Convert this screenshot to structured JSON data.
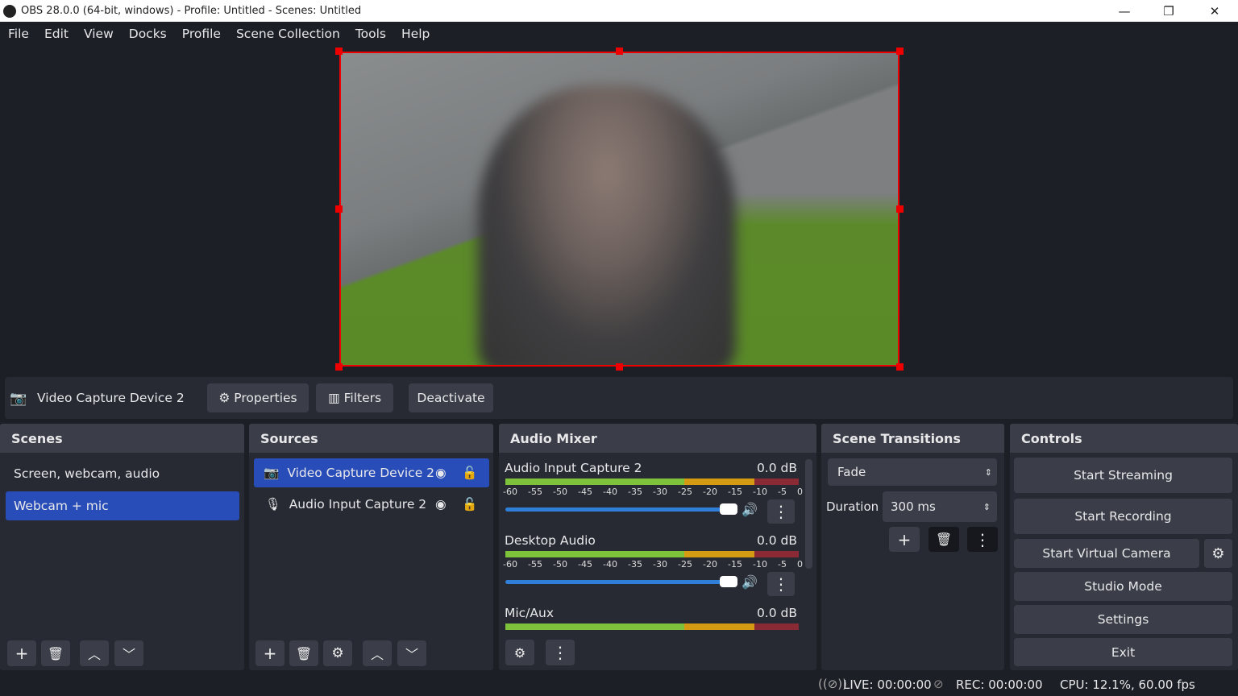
{
  "window": {
    "title": "OBS 28.0.0 (64-bit, windows) - Profile: Untitled - Scenes: Untitled",
    "minimize": "—",
    "restore": "❐",
    "close": "✕"
  },
  "menu": [
    "File",
    "Edit",
    "View",
    "Docks",
    "Profile",
    "Scene Collection",
    "Tools",
    "Help"
  ],
  "source_toolbar": {
    "source_name": "Video Capture Device 2",
    "properties": "Properties",
    "filters": "Filters",
    "deactivate": "Deactivate"
  },
  "scenes": {
    "title": "Scenes",
    "items": [
      "Screen, webcam, audio",
      "Webcam + mic"
    ],
    "selected": "Webcam + mic"
  },
  "sources": {
    "title": "Sources",
    "items": [
      {
        "name": "Video Capture Device 2",
        "icon": "camera-icon",
        "visible": true,
        "locked": false
      },
      {
        "name": "Audio Input Capture 2",
        "icon": "microphone-icon",
        "visible": true,
        "locked": false
      }
    ],
    "selected": "Video Capture Device 2"
  },
  "audio_mixer": {
    "title": "Audio Mixer",
    "ticks": [
      "-60",
      "-55",
      "-50",
      "-45",
      "-40",
      "-35",
      "-30",
      "-25",
      "-20",
      "-15",
      "-10",
      "-5",
      "0"
    ],
    "channels": [
      {
        "name": "Audio Input Capture 2",
        "level": "0.0 dB",
        "volume": 1.0
      },
      {
        "name": "Desktop Audio",
        "level": "0.0 dB",
        "volume": 1.0
      },
      {
        "name": "Mic/Aux",
        "level": "0.0 dB",
        "volume": 1.0
      }
    ]
  },
  "transitions": {
    "title": "Scene Transitions",
    "selected": "Fade",
    "duration_label": "Duration",
    "duration_value": "300 ms"
  },
  "controls": {
    "title": "Controls",
    "start_streaming": "Start Streaming",
    "start_recording": "Start Recording",
    "start_virtual_camera": "Start Virtual Camera",
    "studio_mode": "Studio Mode",
    "settings": "Settings",
    "exit": "Exit"
  },
  "status": {
    "live": "LIVE: 00:00:00",
    "rec": "REC: 00:00:00",
    "cpu": "CPU: 12.1%, 60.00 fps"
  },
  "colors": {
    "selection": "#284cb8",
    "preview_border": "#ee0000",
    "meter_green": "#7ec13a",
    "meter_yellow": "#d49a12",
    "meter_red": "#8a2a35",
    "slider": "#2f7fd8"
  }
}
